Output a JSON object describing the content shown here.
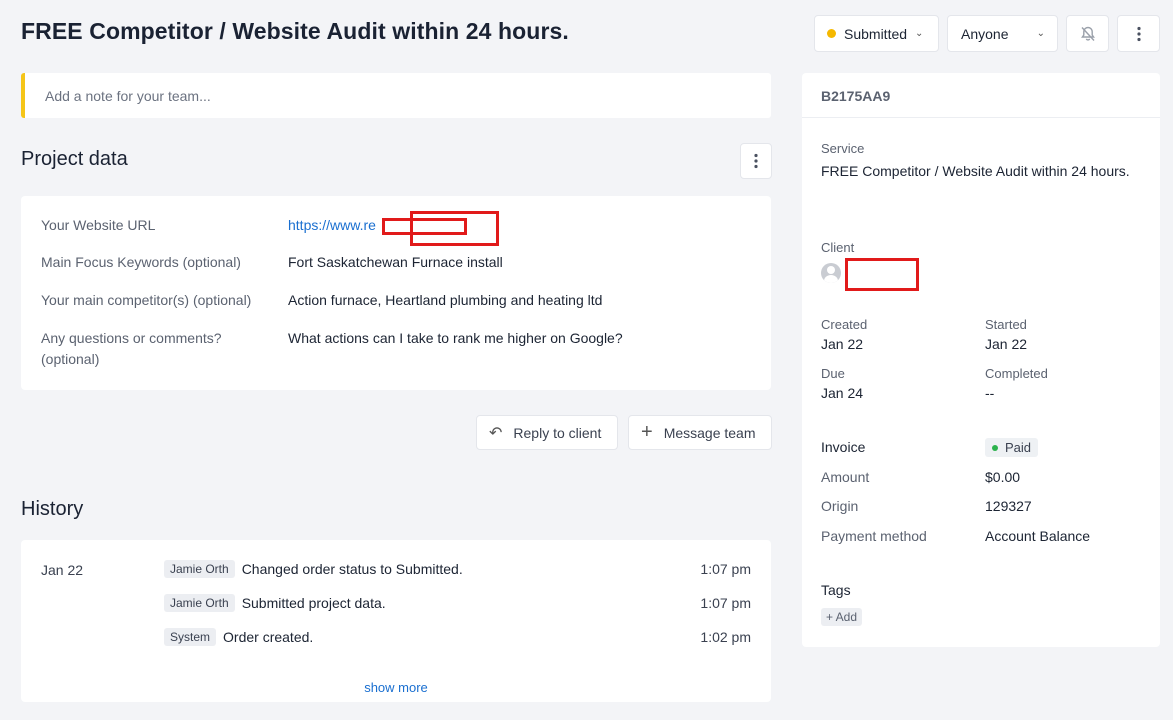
{
  "header": {
    "title": "FREE Competitor / Website Audit within 24 hours.",
    "status_label": "Submitted",
    "status_color": "#f5b800",
    "assignee_label": "Anyone",
    "mute_icon": "bell-slash-icon",
    "more_icon": "vertical-dots-icon"
  },
  "note": {
    "placeholder": "Add a note for your team..."
  },
  "project_data": {
    "title": "Project data",
    "rows": [
      {
        "label": "Your Website URL",
        "value": "https://www.re"
      },
      {
        "label": "Main Focus Keywords (optional)",
        "value": "Fort Saskatchewan Furnace install"
      },
      {
        "label": "Your main competitor(s) (optional)",
        "value": "Action furnace, Heartland plumbing and heating ltd"
      },
      {
        "label": "Any questions or comments? (optional)",
        "value": "What actions can I take to rank me higher on Google?"
      }
    ]
  },
  "actions": {
    "reply_label": "Reply to client",
    "message_label": "Message team"
  },
  "history": {
    "title": "History",
    "date": "Jan 22",
    "entries": [
      {
        "actor": "Jamie Orth",
        "text": "Changed order status to Submitted.",
        "time": "1:07 pm"
      },
      {
        "actor": "Jamie Orth",
        "text": "Submitted project data.",
        "time": "1:07 pm"
      },
      {
        "actor": "System",
        "text": "Order created.",
        "time": "1:02 pm"
      }
    ],
    "show_more": "show more"
  },
  "sidebar": {
    "order_id": "B2175AA9",
    "service_label": "Service",
    "service_value": "FREE Competitor / Website Audit within 24 hours.",
    "client_label": "Client",
    "created_label": "Created",
    "created_value": "Jan 22",
    "started_label": "Started",
    "started_value": "Jan 22",
    "due_label": "Due",
    "due_value": "Jan 24",
    "completed_label": "Completed",
    "completed_value": "--",
    "invoice_label": "Invoice",
    "invoice_status": "Paid",
    "amount_label": "Amount",
    "amount_value": "$0.00",
    "origin_label": "Origin",
    "origin_value": "129327",
    "payment_label": "Payment method",
    "payment_value": "Account Balance",
    "tags_label": "Tags",
    "add_tag_label": "+ Add"
  }
}
